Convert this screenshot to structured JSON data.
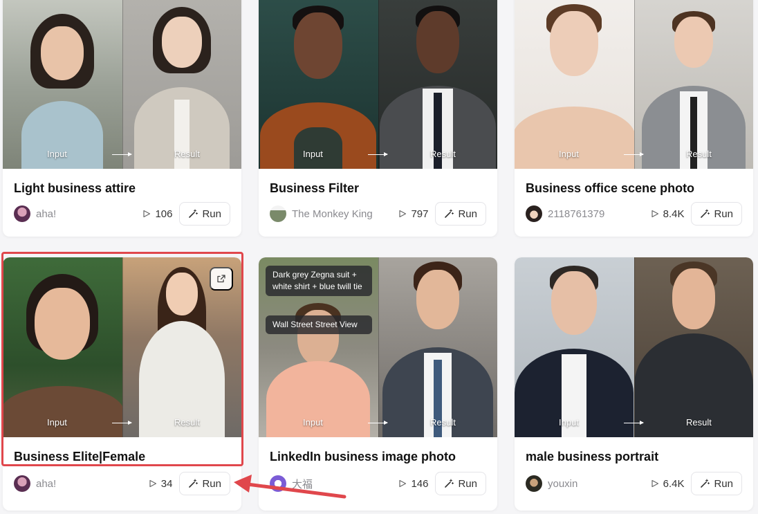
{
  "labels": {
    "input": "Input",
    "result": "Result",
    "run": "Run"
  },
  "cards": [
    {
      "title": "Light business attire",
      "author": "aha!",
      "plays": "106"
    },
    {
      "title": "Business Filter",
      "author": "The Monkey King",
      "plays": "797"
    },
    {
      "title": "Business office scene photo",
      "author": "2118761379",
      "plays": "8.4K"
    },
    {
      "title": "Business Elite|Female",
      "author": "aha!",
      "plays": "34"
    },
    {
      "title": "LinkedIn business image photo",
      "author": "大福",
      "plays": "146",
      "tags": [
        "Dark grey Zegna suit + white shirt + blue twill tie",
        "Wall Street Street View"
      ]
    },
    {
      "title": "male business portrait",
      "author": "youxin",
      "plays": "6.4K"
    }
  ],
  "colors": {
    "highlight": "#e0474c",
    "title": "#111111",
    "author": "#8a8a8f"
  },
  "icons": {
    "run": "magic-wand-icon",
    "plays": "play-icon",
    "share": "share-icon"
  }
}
